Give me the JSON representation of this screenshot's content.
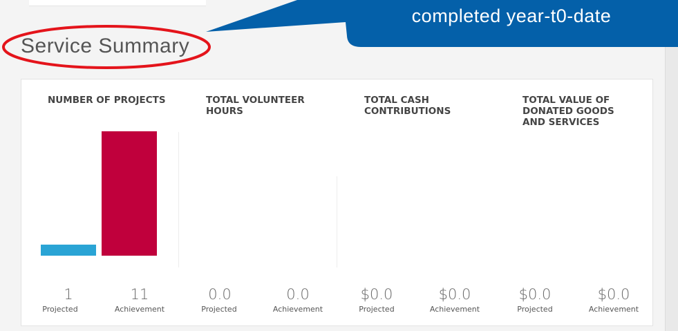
{
  "callout": {
    "text": "completed year-t0-date",
    "color": "#0460a9"
  },
  "section": {
    "title": "Service Summary"
  },
  "annotation": {
    "ellipse_color": "#e4141b"
  },
  "metrics": [
    {
      "title": "NUMBER OF PROJECTS",
      "projected_value": "1",
      "projected_label": "Projected",
      "achievement_value": "11",
      "achievement_label": "Achievement",
      "projected_num": 1,
      "achievement_num": 11,
      "projected_color": "#2aa4d5",
      "achievement_color": "#c0003c"
    },
    {
      "title": "TOTAL VOLUNTEER HOURS",
      "projected_value": "0.0",
      "projected_label": "Projected",
      "achievement_value": "0.0",
      "achievement_label": "Achievement",
      "projected_num": 0,
      "achievement_num": 0
    },
    {
      "title": "TOTAL CASH CONTRIBUTIONS",
      "projected_value": "$0.0",
      "projected_label": "Projected",
      "achievement_value": "$0.0",
      "achievement_label": "Achievement",
      "projected_num": 0,
      "achievement_num": 0
    },
    {
      "title": "TOTAL VALUE OF DONATED GOODS AND SERVICES",
      "projected_value": "$0.0",
      "projected_label": "Projected",
      "achievement_value": "$0.0",
      "achievement_label": "Achievement",
      "projected_num": 0,
      "achievement_num": 0
    }
  ]
}
